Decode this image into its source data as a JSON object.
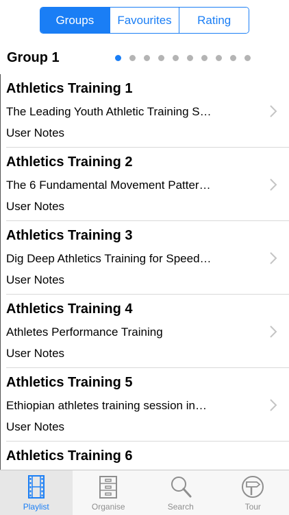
{
  "segments": [
    {
      "label": "Groups",
      "active": true
    },
    {
      "label": "Favourites",
      "active": false
    },
    {
      "label": "Rating",
      "active": false
    }
  ],
  "group": {
    "title": "Group 1",
    "page_count": 10,
    "current_page": 1
  },
  "items": [
    {
      "title": "Athletics Training 1",
      "subtitle": "The Leading Youth Athletic Training S…",
      "notes": "User Notes"
    },
    {
      "title": "Athletics Training 2",
      "subtitle": "The 6 Fundamental Movement Patter…",
      "notes": "User Notes"
    },
    {
      "title": "Athletics Training 3",
      "subtitle": "Dig Deep Athletics Training for Speed…",
      "notes": "User Notes"
    },
    {
      "title": "Athletics Training 4",
      "subtitle": "Athletes Performance Training",
      "notes": "User Notes"
    },
    {
      "title": "Athletics Training 5",
      "subtitle": "Ethiopian athletes training session in…",
      "notes": "User Notes"
    },
    {
      "title": "Athletics Training 6",
      "subtitle": "",
      "notes": ""
    }
  ],
  "tabs": [
    {
      "label": "Playlist",
      "icon": "film-strip-icon",
      "active": true
    },
    {
      "label": "Organise",
      "icon": "cabinet-icon",
      "active": false
    },
    {
      "label": "Search",
      "icon": "magnifier-icon",
      "active": false
    },
    {
      "label": "Tour",
      "icon": "signpost-icon",
      "active": false
    }
  ],
  "colors": {
    "accent": "#1a7ef5",
    "inactive": "#8e8e8e"
  }
}
